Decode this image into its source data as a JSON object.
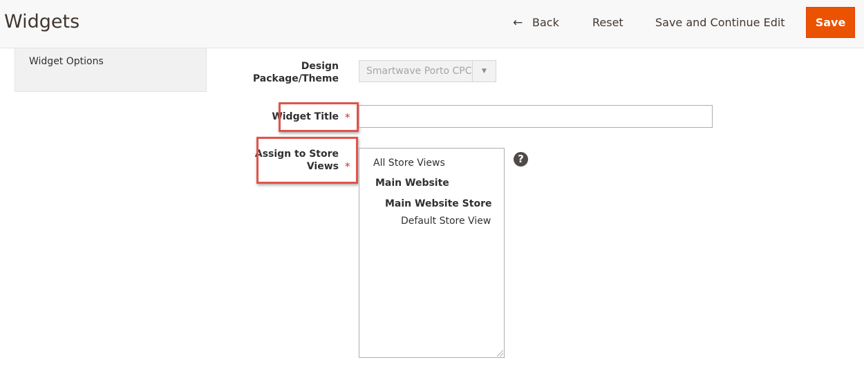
{
  "header": {
    "title": "Widgets",
    "back_label": "Back",
    "reset_label": "Reset",
    "save_continue_label": "Save and Continue Edit",
    "save_label": "Save"
  },
  "tabs": {
    "widget_options": "Widget Options"
  },
  "form": {
    "design_label": "Design Package/Theme",
    "design_value": "Smartwave Porto CPC",
    "title_label": "Widget Title",
    "title_value": "",
    "assign_label": "Assign to Store Views",
    "required_mark": "*",
    "store_options": {
      "all": "All Store Views",
      "website": "Main Website",
      "store": "Main Website Store",
      "view": "Default Store View"
    }
  },
  "colors": {
    "accent": "#eb5202",
    "highlight": "#e2534a",
    "required": "#e22626"
  }
}
